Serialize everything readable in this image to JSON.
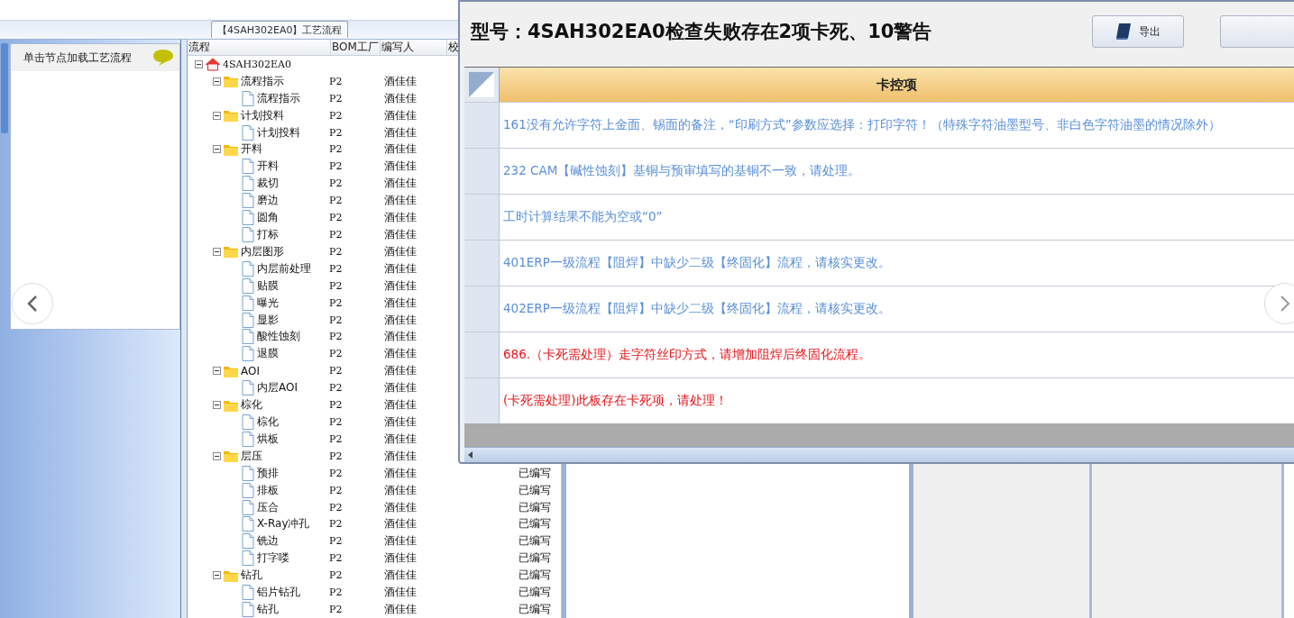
{
  "top_tab": {
    "label": "【4SAH302EA0】工艺流程"
  },
  "side_panel": {
    "title": "单击节点加载工艺流程"
  },
  "tree_table": {
    "columns": [
      "流程",
      "BOM工厂",
      "编写人",
      "校"
    ],
    "root": {
      "label": "4SAH302EA0",
      "expanded": true,
      "children": [
        {
          "label": "流程指示",
          "bom": "P2",
          "author": "酒佳佳",
          "expanded": true,
          "children": [
            {
              "label": "流程指示",
              "bom": "P2",
              "author": "酒佳佳"
            }
          ]
        },
        {
          "label": "计划投料",
          "bom": "P2",
          "author": "酒佳佳",
          "expanded": true,
          "children": [
            {
              "label": "计划投料",
              "bom": "P2",
              "author": "酒佳佳"
            }
          ]
        },
        {
          "label": "开料",
          "bom": "P2",
          "author": "酒佳佳",
          "expanded": true,
          "children": [
            {
              "label": "开料",
              "bom": "P2",
              "author": "酒佳佳"
            },
            {
              "label": "裁切",
              "bom": "P2",
              "author": "酒佳佳"
            },
            {
              "label": "磨边",
              "bom": "P2",
              "author": "酒佳佳"
            },
            {
              "label": "圆角",
              "bom": "P2",
              "author": "酒佳佳"
            },
            {
              "label": "打标",
              "bom": "P2",
              "author": "酒佳佳"
            }
          ]
        },
        {
          "label": "内层图形",
          "bom": "P2",
          "author": "酒佳佳",
          "expanded": true,
          "children": [
            {
              "label": "内层前处理",
              "bom": "P2",
              "author": "酒佳佳"
            },
            {
              "label": "贴膜",
              "bom": "P2",
              "author": "酒佳佳"
            },
            {
              "label": "曝光",
              "bom": "P2",
              "author": "酒佳佳"
            },
            {
              "label": "显影",
              "bom": "P2",
              "author": "酒佳佳"
            },
            {
              "label": "酸性蚀刻",
              "bom": "P2",
              "author": "酒佳佳"
            },
            {
              "label": "退膜",
              "bom": "P2",
              "author": "酒佳佳"
            }
          ]
        },
        {
          "label": "AOI",
          "bom": "P2",
          "author": "酒佳佳",
          "expanded": true,
          "children": [
            {
              "label": "内层AOI",
              "bom": "P2",
              "author": "酒佳佳"
            }
          ]
        },
        {
          "label": "棕化",
          "bom": "P2",
          "author": "酒佳佳",
          "expanded": true,
          "children": [
            {
              "label": "棕化",
              "bom": "P2",
              "author": "酒佳佳"
            },
            {
              "label": "烘板",
              "bom": "P2",
              "author": "酒佳佳"
            }
          ]
        },
        {
          "label": "层压",
          "bom": "P2",
          "author": "酒佳佳",
          "expanded": true,
          "children": [
            {
              "label": "预排",
              "bom": "P2",
              "author": "酒佳佳",
              "status": "已编写"
            },
            {
              "label": "排板",
              "bom": "P2",
              "author": "酒佳佳",
              "status": "已编写"
            },
            {
              "label": "压合",
              "bom": "P2",
              "author": "酒佳佳",
              "status": "已编写"
            },
            {
              "label": "X-Ray冲孔",
              "bom": "P2",
              "author": "酒佳佳",
              "status": "已编写"
            },
            {
              "label": "铣边",
              "bom": "P2",
              "author": "酒佳佳",
              "status": "已编写"
            },
            {
              "label": "打字喽",
              "bom": "P2",
              "author": "酒佳佳",
              "status": "已编写"
            }
          ]
        },
        {
          "label": "钻孔",
          "bom": "P2",
          "author": "酒佳佳",
          "status": "已编写",
          "expanded": true,
          "children": [
            {
              "label": "铝片钻孔",
              "bom": "P2",
              "author": "酒佳佳",
              "status": "已编写"
            },
            {
              "label": "钻孔",
              "bom": "P2",
              "author": "酒佳佳",
              "status": "已编写"
            }
          ]
        }
      ]
    }
  },
  "dialog": {
    "title": "型号：4SAH302EA0检查失败存在2项卡死、10警告",
    "buttons": [
      "导出"
    ],
    "grid": {
      "column": "卡控项",
      "rows": [
        {
          "kind": "warning",
          "text": "161没有允许字符上金面、锡面的备注，“印刷方式”参数应选择：打印字符！（特殊字符油墨型号、非白色字符油墨的情况除外）"
        },
        {
          "kind": "warning",
          "text": "232 CAM【碱性蚀刻】基铜与预审填写的基铜不一致，请处理。"
        },
        {
          "kind": "warning",
          "text": "工时计算结果不能为空或“0”"
        },
        {
          "kind": "warning",
          "text": "401ERP一级流程【阻焊】中缺少二级【终固化】流程，请核实更改。"
        },
        {
          "kind": "warning",
          "text": "402ERP一级流程【阻焊】中缺少二级【终固化】流程，请核实更改。"
        },
        {
          "kind": "blocking",
          "text": "686.（卡死需处理）走字符丝印方式，请增加阻焊后终固化流程。"
        },
        {
          "kind": "blocking",
          "text": "(卡死需处理)此板存在卡死项，请处理！"
        }
      ]
    }
  }
}
